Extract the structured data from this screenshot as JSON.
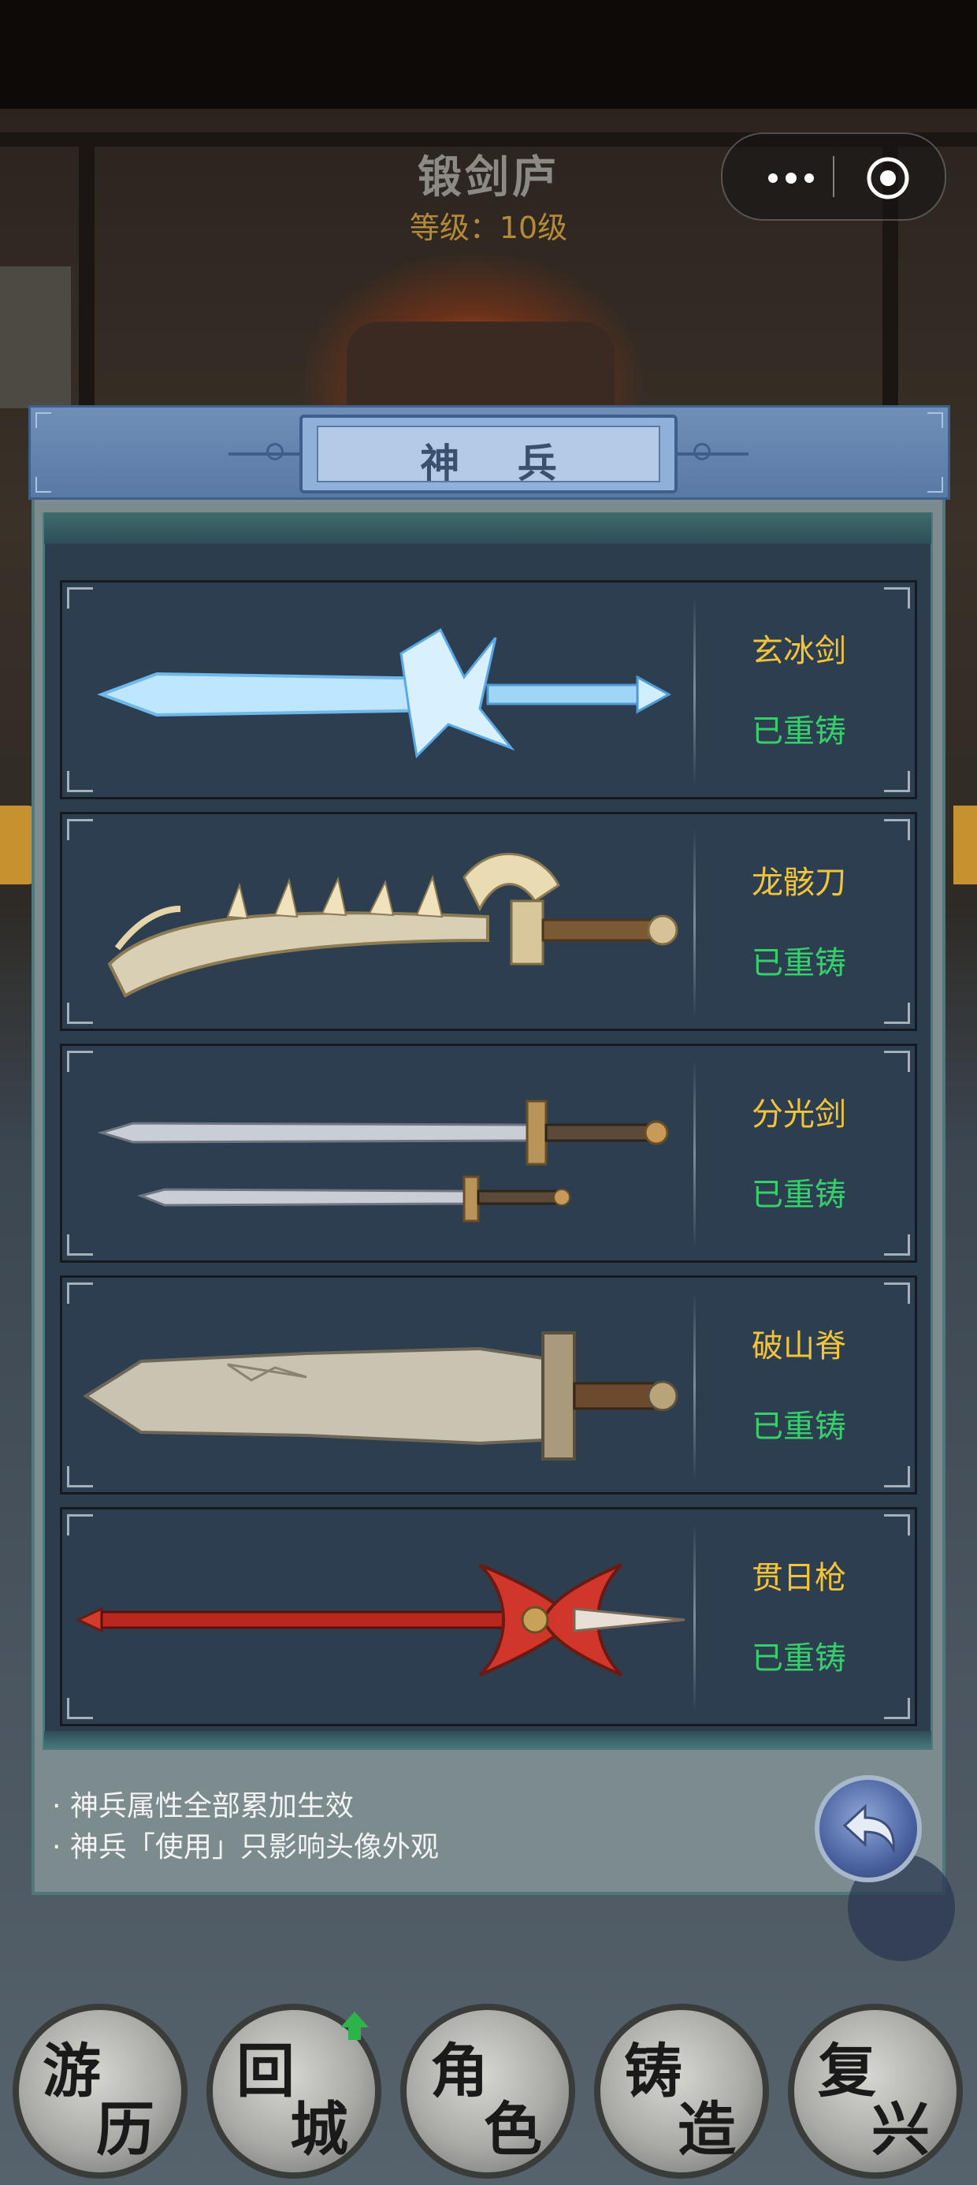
{
  "header": {
    "title": "锻剑庐",
    "level": "等级：10级"
  },
  "capsule": {
    "more_icon": "more-dots-icon",
    "close_icon": "target-icon"
  },
  "panel": {
    "title": "神 兵",
    "weapons": [
      {
        "name": "玄冰剑",
        "status": "已重铸"
      },
      {
        "name": "龙骸刀",
        "status": "已重铸"
      },
      {
        "name": "分光剑",
        "status": "已重铸"
      },
      {
        "name": "破山脊",
        "status": "已重铸"
      },
      {
        "name": "贯日枪",
        "status": "已重铸"
      }
    ],
    "notes": [
      "· 神兵属性全部累加生效",
      "· 神兵「使用」只影响头像外观"
    ],
    "back_icon": "back-arrow-icon"
  },
  "nav": [
    {
      "c1": "游",
      "c2": "历"
    },
    {
      "c1": "回",
      "c2": "城"
    },
    {
      "c1": "角",
      "c2": "色"
    },
    {
      "c1": "铸",
      "c2": "造"
    },
    {
      "c1": "复",
      "c2": "兴"
    }
  ],
  "colors": {
    "name": "#f2c43a",
    "status": "#35d06a",
    "badge": "#2db34a"
  }
}
